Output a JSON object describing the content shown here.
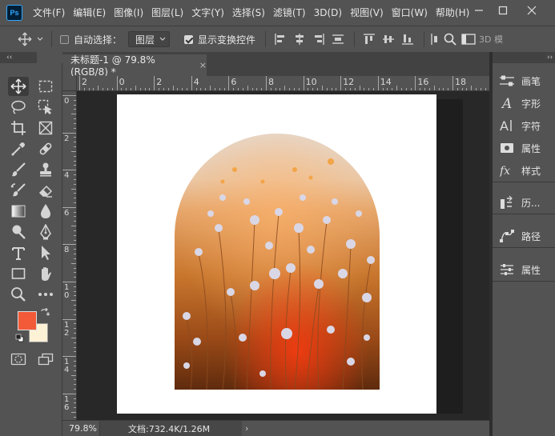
{
  "app": {
    "logo_text": "Ps"
  },
  "menu": [
    "文件(F)",
    "编辑(E)",
    "图像(I)",
    "图层(L)",
    "文字(Y)",
    "选择(S)",
    "滤镜(T)",
    "3D(D)",
    "视图(V)",
    "窗口(W)",
    "帮助(H)"
  ],
  "options": {
    "auto_select_label": "自动选择：",
    "auto_select_checked": false,
    "layer_select_value": "图层",
    "show_transform_label": "显示变换控件",
    "show_transform_checked": true,
    "mode_3d_label": "3D 模"
  },
  "collapse_glyph": "‹‹",
  "collapse_glyph_right": "››",
  "document": {
    "tab_title": "未标题-1 @ 79.8%(RGB/8) *",
    "close_glyph": "×"
  },
  "rulers": {
    "horizontal": [
      "2",
      "0",
      "2",
      "4",
      "6",
      "8",
      "10",
      "12",
      "14",
      "16",
      "18"
    ],
    "vertical": [
      "0",
      "2",
      "4",
      "6",
      "8",
      "1\n0",
      "1\n2",
      "1\n4",
      "1\n6"
    ]
  },
  "status": {
    "zoom": "79.8%",
    "doc_info": "文档:732.4K/1.26M",
    "arrow": "›"
  },
  "colors": {
    "foreground": "#f25a38",
    "background": "#fdf1d6",
    "accent": "#31a8ff"
  },
  "right_panel": [
    {
      "label": "画笔",
      "icon": "brush-settings-icon"
    },
    {
      "label": "字形",
      "icon": "glyphs-icon"
    },
    {
      "label": "字符",
      "icon": "character-icon"
    },
    {
      "label": "属性",
      "icon": "properties-icon"
    },
    {
      "label": "样式",
      "icon": "styles-icon"
    },
    {
      "label": "历...",
      "icon": "history-icon"
    },
    {
      "label": "路径",
      "icon": "paths-icon"
    },
    {
      "label": "属性",
      "icon": "adjustments-properties-icon"
    }
  ]
}
